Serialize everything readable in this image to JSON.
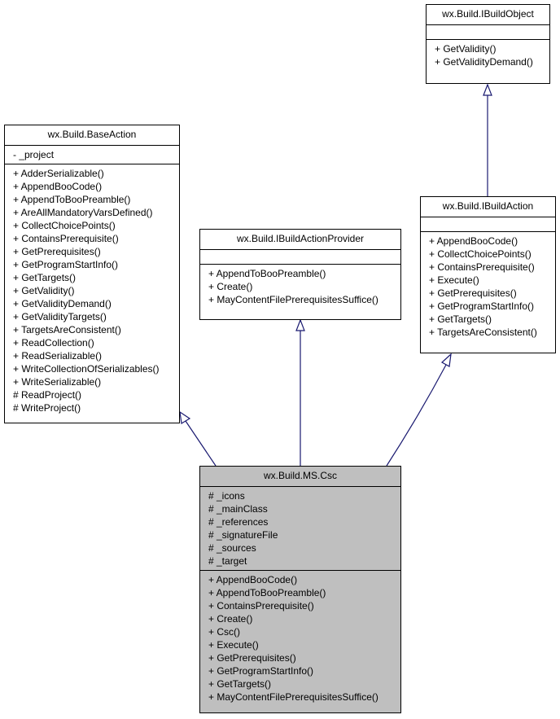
{
  "diagram": {
    "classes": {
      "ibuildobject": {
        "name": "wx.Build.IBuildObject",
        "attributes": [],
        "methods": [
          "+ GetValidity()",
          "+ GetValidityDemand()"
        ]
      },
      "baseaction": {
        "name": "wx.Build.BaseAction",
        "attributes": [
          "- _project"
        ],
        "methods": [
          "+ AdderSerializable()",
          "+ AppendBooCode()",
          "+ AppendToBooPreamble()",
          "+ AreAllMandatoryVarsDefined()",
          "+ CollectChoicePoints()",
          "+ ContainsPrerequisite()",
          "+ GetPrerequisites()",
          "+ GetProgramStartInfo()",
          "+ GetTargets()",
          "+ GetValidity()",
          "+ GetValidityDemand()",
          "+ GetValidityTargets()",
          "+ TargetsAreConsistent()",
          "+ ReadCollection()",
          "+ ReadSerializable()",
          "+ WriteCollectionOfSerializables()",
          "+ WriteSerializable()",
          "# ReadProject()",
          "# WriteProject()"
        ]
      },
      "ibuildactionprovider": {
        "name": "wx.Build.IBuildActionProvider",
        "attributes": [],
        "methods": [
          "+ AppendToBooPreamble()",
          "+ Create()",
          "+ MayContentFilePrerequisitesSuffice()"
        ]
      },
      "ibuildaction": {
        "name": "wx.Build.IBuildAction",
        "attributes": [],
        "methods": [
          "+ AppendBooCode()",
          "+ CollectChoicePoints()",
          "+ ContainsPrerequisite()",
          "+ Execute()",
          "+ GetPrerequisites()",
          "+ GetProgramStartInfo()",
          "+ GetTargets()",
          "+ TargetsAreConsistent()"
        ]
      },
      "csc": {
        "name": "wx.Build.MS.Csc",
        "attributes": [
          "# _icons",
          "# _mainClass",
          "# _references",
          "# _signatureFile",
          "# _sources",
          "# _target"
        ],
        "methods": [
          "+ AppendBooCode()",
          "+ AppendToBooPreamble()",
          "+ ContainsPrerequisite()",
          "+ Create()",
          "+ Csc()",
          "+ Execute()",
          "+ GetPrerequisites()",
          "+ GetProgramStartInfo()",
          "+ GetTargets()",
          "+ MayContentFilePrerequisitesSuffice()"
        ]
      }
    },
    "edges": [
      {
        "from": "ibuildaction",
        "to": "ibuildobject",
        "type": "inheritance"
      },
      {
        "from": "csc",
        "to": "baseaction",
        "type": "inheritance"
      },
      {
        "from": "csc",
        "to": "ibuildactionprovider",
        "type": "inheritance"
      },
      {
        "from": "csc",
        "to": "ibuildaction",
        "type": "inheritance"
      }
    ],
    "colors": {
      "edge": "#191970",
      "focus_fill": "#bfbfbf",
      "border": "#000000"
    }
  }
}
